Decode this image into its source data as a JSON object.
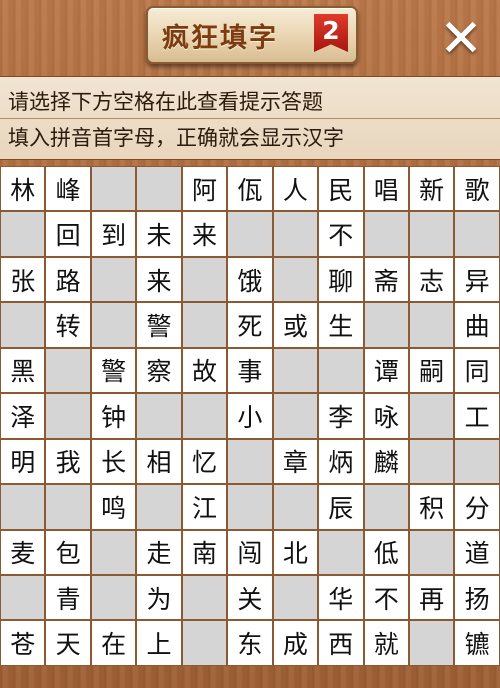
{
  "header": {
    "title": "疯狂填字",
    "badge": "2",
    "close_label": "✕"
  },
  "hints": {
    "line1": "请选择下方空格在此查看提示答题",
    "line2": "填入拼音首字母，正确就会显示汉字"
  },
  "grid": [
    [
      "林",
      "峰",
      "",
      "",
      "阿",
      "佤",
      "人",
      "民",
      "唱",
      "新",
      "歌"
    ],
    [
      "",
      "回",
      "到",
      "未",
      "来",
      "",
      "",
      "不",
      "",
      "",
      ""
    ],
    [
      "张",
      "路",
      "",
      "来",
      "",
      "饿",
      "",
      "聊",
      "斋",
      "志",
      "异"
    ],
    [
      "",
      "转",
      "",
      "警",
      "",
      "死",
      "或",
      "生",
      "",
      "",
      "曲"
    ],
    [
      "黑",
      "",
      "警",
      "察",
      "故",
      "事",
      "",
      "",
      "谭",
      "嗣",
      "同"
    ],
    [
      "泽",
      "",
      "钟",
      "",
      "",
      "小",
      "",
      "李",
      "咏",
      "",
      "工"
    ],
    [
      "明",
      "我",
      "长",
      "相",
      "忆",
      "",
      "章",
      "炳",
      "麟",
      "",
      ""
    ],
    [
      "",
      "",
      "鸣",
      "",
      "江",
      "",
      "",
      "辰",
      "",
      "积",
      "分"
    ],
    [
      "麦",
      "包",
      "",
      "走",
      "南",
      "闯",
      "北",
      "",
      "低",
      "",
      "道"
    ],
    [
      "",
      "青",
      "",
      "为",
      "",
      "关",
      "",
      "华",
      "不",
      "再",
      "扬"
    ],
    [
      "苍",
      "天",
      "在",
      "上",
      "",
      "东",
      "成",
      "西",
      "就",
      "",
      "镳"
    ]
  ]
}
